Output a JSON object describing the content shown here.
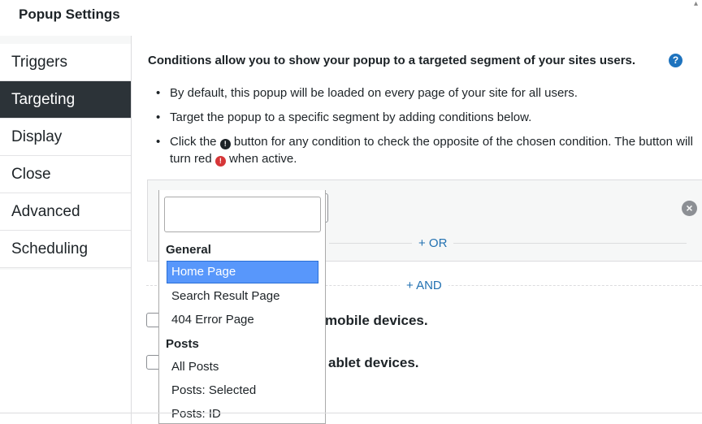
{
  "header": {
    "title": "Popup Settings"
  },
  "tabs": [
    {
      "label": "Triggers",
      "active": false
    },
    {
      "label": "Targeting",
      "active": true
    },
    {
      "label": "Display",
      "active": false
    },
    {
      "label": "Close",
      "active": false
    },
    {
      "label": "Advanced",
      "active": false
    },
    {
      "label": "Scheduling",
      "active": false
    }
  ],
  "targeting": {
    "intro": "Conditions allow you to show your popup to a targeted segment of your sites users.",
    "help_icon": "?",
    "bullets": {
      "b1": "By default, this popup will be loaded on every page of your site for all users.",
      "b2": "Target the popup to a specific segment by adding conditions below.",
      "b3_pre": "Click the",
      "b3_mid": "button for any condition to check the opposite of the chosen condition. The button will turn red",
      "b3_post": "when active."
    },
    "or_label": "+ OR",
    "and_label": "+ AND",
    "remove_icon": "×",
    "checks": {
      "mobile": "mobile devices.",
      "tablet": "ablet devices."
    }
  },
  "dropdown": {
    "search_value": "",
    "groups": [
      {
        "label": "General",
        "items": [
          "Home Page",
          "Search Result Page",
          "404 Error Page"
        ]
      },
      {
        "label": "Posts",
        "items": [
          "All Posts",
          "Posts: Selected",
          "Posts: ID"
        ]
      }
    ],
    "highlighted": "Home Page"
  },
  "colors": {
    "accent": "#2271b1",
    "active_tab": "#2c3338",
    "highlight": "#5897fb",
    "not_active": "#d63638"
  }
}
